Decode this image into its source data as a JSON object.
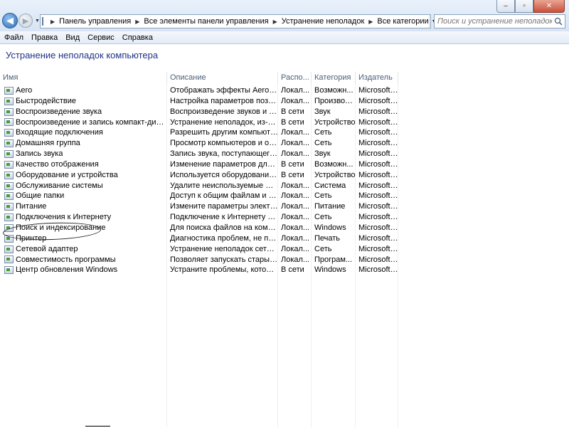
{
  "window": {
    "minimize_glyph": "–",
    "maximize_glyph": "▫",
    "close_glyph": "✕"
  },
  "nav": {
    "back_glyph": "◀",
    "forward_glyph": "▶",
    "dropdown_glyph": "▼"
  },
  "address": {
    "crumbs": [
      "Панель управления",
      "Все элементы панели управления",
      "Устранение неполадок",
      "Все категории"
    ],
    "separator": "▶",
    "dropdown_glyph": "▼",
    "refresh_glyph": "↻"
  },
  "search": {
    "placeholder": "Поиск и устранение неполадок"
  },
  "menu": [
    "Файл",
    "Правка",
    "Вид",
    "Сервис",
    "Справка"
  ],
  "page": {
    "title": "Устранение неполадок компьютера"
  },
  "table": {
    "columns": [
      "Имя",
      "Описание",
      "Распо...",
      "Категория",
      "Издатель"
    ],
    "rows": [
      [
        "Aero",
        "Отображать эффекты Aero, так...",
        "Локал...",
        "Возможн...",
        "Microsoft ..."
      ],
      [
        "Быстродействие",
        "Настройка параметров позволя...",
        "Локал...",
        "Производ...",
        "Microsoft ..."
      ],
      [
        "Воспроизведение звука",
        "Воспроизведение звуков и ауди...",
        "В сети",
        "Звук",
        "Microsoft ..."
      ],
      [
        "Воспроизведение и запись компакт-дисков, D...",
        "Устранение неполадок, из-за ко...",
        "В сети",
        "Устройство",
        "Microsoft ..."
      ],
      [
        "Входящие подключения",
        "Разрешить другим компьютера...",
        "Локал...",
        "Сеть",
        "Microsoft ..."
      ],
      [
        "Домашняя группа",
        "Просмотр компьютеров и общ...",
        "Локал...",
        "Сеть",
        "Microsoft ..."
      ],
      [
        "Запись звука",
        "Запись звука, поступающего с ...",
        "Локал...",
        "Звук",
        "Microsoft ..."
      ],
      [
        "Качество отображения",
        "Изменение параметров для улу...",
        "В сети",
        "Возможн...",
        "Microsoft ..."
      ],
      [
        "Оборудование и устройства",
        "Используется оборудование и у...",
        "В сети",
        "Устройство",
        "Microsoft ..."
      ],
      [
        "Обслуживание системы",
        "Удалите неиспользуемые файл...",
        "Локал...",
        "Система",
        "Microsoft ..."
      ],
      [
        "Общие папки",
        "Доступ к общим файлам и пап...",
        "Локал...",
        "Сеть",
        "Microsoft ..."
      ],
      [
        "Питание",
        "Измените параметры электроп...",
        "Локал...",
        "Питание",
        "Microsoft ..."
      ],
      [
        "Подключения к Интернету",
        "Подключение к Интернету или ...",
        "Локал...",
        "Сеть",
        "Microsoft ..."
      ],
      [
        "Поиск и индексирование",
        "Для поиска файлов на компьют...",
        "Локал...",
        "Windows",
        "Microsoft ..."
      ],
      [
        "Принтер",
        "Диагностика проблем, не позво...",
        "Локал...",
        "Печать",
        "Microsoft ..."
      ],
      [
        "Сетевой адаптер",
        "Устранение неполадок сетевых ...",
        "Локал...",
        "Сеть",
        "Microsoft ..."
      ],
      [
        "Совместимость программы",
        "Позволяет запускать старые пр...",
        "Локал...",
        "Програм...",
        "Microsoft ..."
      ],
      [
        "Центр обновления Windows",
        "Устраните проблемы, которые ...",
        "В сети",
        "Windows",
        "Microsoft ..."
      ]
    ]
  },
  "colors": {
    "title": "#1e3287",
    "header_text": "#4c607a"
  }
}
